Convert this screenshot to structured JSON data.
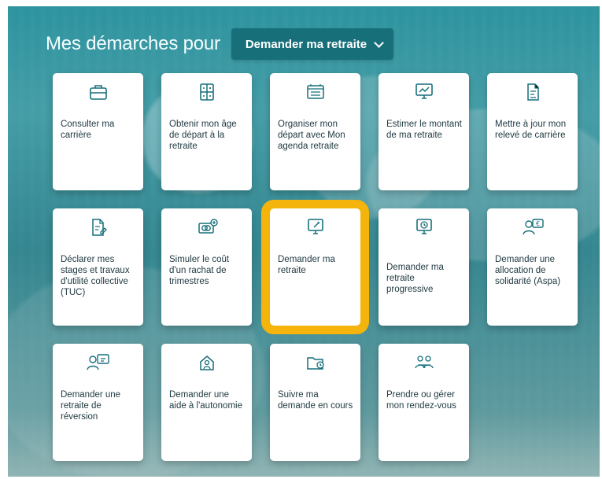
{
  "header": {
    "title": "Mes démarches pour",
    "selected_process": "Demander ma retraite"
  },
  "tiles": [
    {
      "label": "Consulter ma carrière",
      "icon": "briefcase-icon"
    },
    {
      "label": "Obtenir mon âge de départ à la retraite",
      "icon": "calculator-icon"
    },
    {
      "label": "Organiser mon départ avec Mon agenda retraite",
      "icon": "calendar-icon"
    },
    {
      "label": "Estimer le montant de ma retraite",
      "icon": "monitor-chart-icon"
    },
    {
      "label": "Mettre à jour mon relevé de carrière",
      "icon": "document-check-icon"
    },
    {
      "label": "Déclarer mes stages et travaux d'utilité collective (TUC)",
      "icon": "document-edit-icon"
    },
    {
      "label": "Simuler le coût d'un rachat de trimestres",
      "icon": "coins-plus-icon"
    },
    {
      "label": "Demander ma retraite",
      "icon": "monitor-pen-icon",
      "active": true
    },
    {
      "label": "Demander ma retraite progressive",
      "icon": "monitor-clock-icon"
    },
    {
      "label": "Demander une allocation de solidarité (Aspa)",
      "icon": "users-euro-icon"
    },
    {
      "label": "Demander une retraite de réversion",
      "icon": "users-document-icon"
    },
    {
      "label": "Demander une aide à l'autonomie",
      "icon": "house-person-icon"
    },
    {
      "label": "Suivre ma demande en cours",
      "icon": "folder-clock-icon"
    },
    {
      "label": "Prendre ou gérer mon rendez-vous",
      "icon": "meeting-icon"
    }
  ],
  "colors": {
    "accent": "#176f7a",
    "highlight": "#f5b40c"
  }
}
